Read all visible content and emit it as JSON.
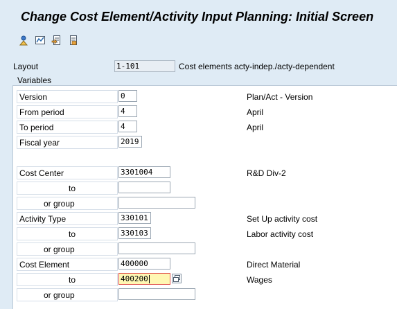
{
  "window": {
    "title": "Change Cost Element/Activity Input Planning: Initial Screen"
  },
  "toolbar": {
    "icons": [
      "person-icon",
      "overview-icon",
      "open-document-icon",
      "save-document-icon"
    ]
  },
  "layout": {
    "label": "Layout",
    "value": "1-101",
    "description": "Cost elements acty-indep./acty-dependent"
  },
  "variables": {
    "title": "Variables",
    "version": {
      "label": "Version",
      "value": "0",
      "description": "Plan/Act - Version"
    },
    "from_period": {
      "label": "From period",
      "value": "4",
      "description": "April"
    },
    "to_period": {
      "label": "To period",
      "value": "4",
      "description": "April"
    },
    "fiscal_year": {
      "label": "Fiscal year",
      "value": "2019"
    },
    "cost_center": {
      "label": "Cost Center",
      "value": "3301004",
      "description": "R&D Div-2"
    },
    "cost_center_to": {
      "label": "to",
      "value": ""
    },
    "cost_center_group": {
      "label": "or group",
      "value": ""
    },
    "activity_type": {
      "label": "Activity Type",
      "value": "330101",
      "description": "Set Up activity cost"
    },
    "activity_type_to": {
      "label": "to",
      "value": "330103",
      "description": "Labor activity cost"
    },
    "activity_type_group": {
      "label": "or group",
      "value": ""
    },
    "cost_element": {
      "label": "Cost Element",
      "value": "400000",
      "description": "Direct Material"
    },
    "cost_element_to": {
      "label": "to",
      "value": "400200",
      "description": "Wages"
    },
    "cost_element_group": {
      "label": "or group",
      "value": ""
    }
  }
}
